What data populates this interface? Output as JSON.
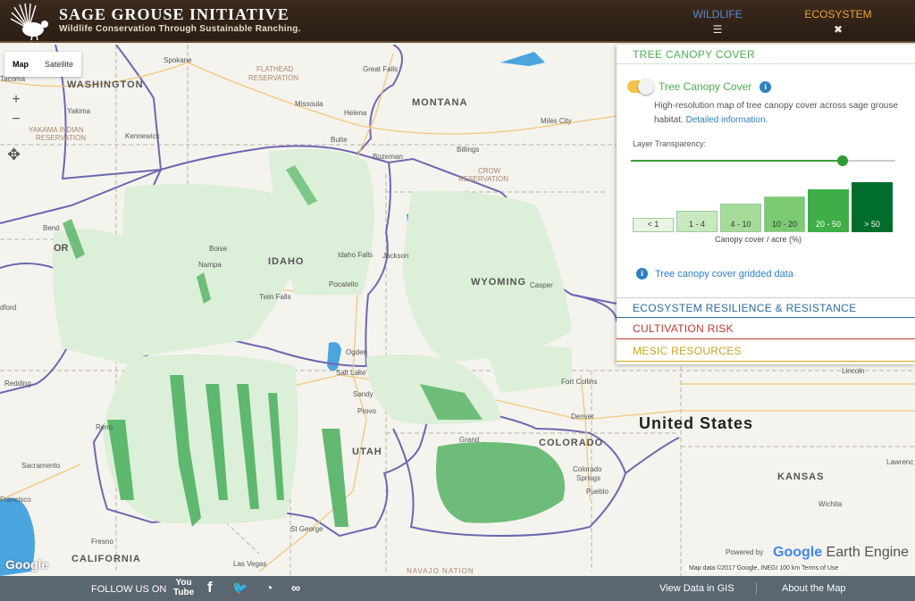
{
  "header": {
    "title": "SAGE GROUSE INITIATIVE",
    "subtitle": "Wildlife Conservation Through Sustainable Ranching.",
    "nav": [
      {
        "label": "WILDLIFE",
        "icon": "list-icon"
      },
      {
        "label": "ECOSYSTEM",
        "icon": "close-icon"
      }
    ]
  },
  "map": {
    "type_controls": {
      "map": "Map",
      "satellite": "Satellite"
    },
    "zoom_in": "+",
    "zoom_out": "−",
    "labels": {
      "spokane": "Spokane",
      "washington": "WASHINGTON",
      "tacoma": "Tacoma",
      "yakima": "Yakima",
      "yakama": "YAKAMA INDIAN",
      "yakama2": "RESERVATION",
      "kennewick": "Kennewick",
      "flathead": "FLATHEAD",
      "flathead2": "RESERVATION",
      "greatfalls": "Great Falls",
      "montana": "MONTANA",
      "missoula": "Missoula",
      "helena": "Helena",
      "milescity": "Miles City",
      "butte": "Butte",
      "bozeman": "Bozeman",
      "billings": "Billings",
      "crow": "CROW",
      "crow2": "RESERVATION",
      "bend": "Bend",
      "or": "OR",
      "boise": "Boise",
      "nampa": "Nampa",
      "idaho": "IDAHO",
      "idahofalls": "Idaho Falls",
      "jackson": "Jackson",
      "twinfalls": "Twin Falls",
      "pocatello": "Pocatello",
      "wyoming": "WYOMING",
      "casper": "Casper",
      "medford": "dford",
      "redding": "Redding",
      "ogden": "Ogden",
      "saltlake": "Salt Lake",
      "sandy": "Sandy",
      "provo": "Provo",
      "utah": "UTAH",
      "reno": "Reno",
      "sacramento": "Sacramento",
      "sanfrancisco": "Francisco",
      "grand": "Grand",
      "colorado": "COLORADO",
      "fortcollins": "Fort Collins",
      "denver": "Denver",
      "coloradosprings": "Colorado",
      "coloradosprings2": "Springs",
      "pueblo": "Pueblo",
      "unitedstates": "United States",
      "lincoln": "Lincoln",
      "kansas": "KANSAS",
      "lawrence": "Lawrenc",
      "wichita": "Wichita",
      "fresno": "Fresno",
      "california": "CALIFORNIA",
      "stgeorge": "St George",
      "lasvegas": "Las Vegas",
      "navajo": "NAVAJO NATION"
    },
    "google": "Google",
    "powered": "Powered by",
    "gee_google": "Google",
    "gee_engine": " Earth Engine",
    "attribution": "Map data ©2017 Google, INEGI   100 km        Terms of Use"
  },
  "panel": {
    "header": "TREE CANOPY COVER",
    "layer_label": "Tree Canopy Cover",
    "layer_on": true,
    "description": "High-resolution map of tree canopy cover across sage grouse habitat.",
    "detail_link": "Detailed information.",
    "transparency_label": "Layer Transparency:",
    "transparency_value": 0.8,
    "legend": [
      {
        "label": "< 1",
        "color": "#e8f5e2"
      },
      {
        "label": "1 - 4",
        "color": "#c8e8c0"
      },
      {
        "label": "4 - 10",
        "color": "#a5dc9a"
      },
      {
        "label": "10 - 20",
        "color": "#7cca72"
      },
      {
        "label": "20 - 50",
        "color": "#3fae49"
      },
      {
        "label": "> 50",
        "color": "#006d2c"
      }
    ],
    "legend_caption": "Canopy cover / acre (%)",
    "grid_link": "Tree canopy cover gridded data",
    "sections": [
      {
        "label": "ECOSYSTEM RESILIENCE & RESISTANCE",
        "color": "#2c6d9c"
      },
      {
        "label": "CULTIVATION RISK",
        "color": "#c0392b"
      },
      {
        "label": "MESIC RESOURCES",
        "color": "#c8a421"
      }
    ]
  },
  "footer": {
    "follow": "FOLLOW US ON",
    "social": [
      "youtube-icon",
      "facebook-icon",
      "twitter-icon",
      "rss-icon",
      "link-icon"
    ],
    "view_data": "View Data in GIS",
    "about": "About the Map"
  }
}
